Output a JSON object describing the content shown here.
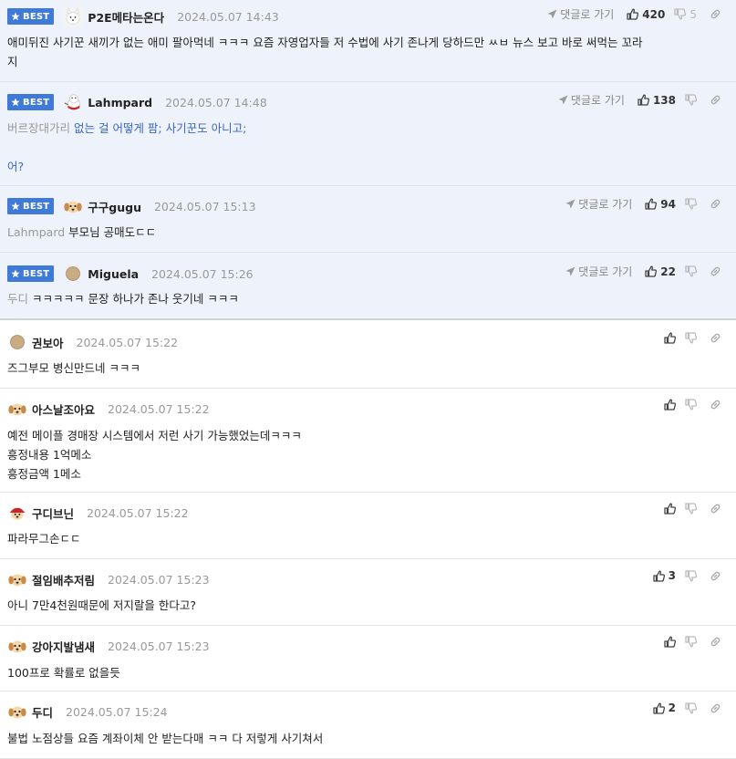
{
  "labels": {
    "best": "BEST",
    "reply": "댓글로 가기"
  },
  "colors": {
    "best_bg": "#eef2fb",
    "badge": "#3f7ad8",
    "mention_gray": "#999999",
    "link_blue": "#3a66c4"
  },
  "comments": [
    {
      "best": true,
      "avatar": "white-dog-icon",
      "nick": "P2E메타는온다",
      "date": "2024.05.07 14:43",
      "likes": "420",
      "dislikes": "5",
      "mention": "",
      "lines": [
        "애미뒤진 사기꾼 새끼가 없는 애미 팔아먹네 ㅋㅋㅋ 요즘 자영업자들 저 수법에 사기 존나게 당하드만 ㅆㅂ 뉴스 보고 바로 써먹는 꼬라",
        "지"
      ]
    },
    {
      "best": true,
      "avatar": "snowman-icon",
      "nick": "Lahmpard",
      "date": "2024.05.07 14:48",
      "likes": "138",
      "dislikes": "",
      "mention": "버르장대가리",
      "lines": [
        "없는 걸 어떻게 팜; 사기꾼도 아니고;",
        "",
        "어?"
      ]
    },
    {
      "best": true,
      "avatar": "puppy-icon",
      "nick": "구구gugu",
      "date": "2024.05.07 15:13",
      "likes": "94",
      "dislikes": "",
      "mention": "Lahmpard",
      "lines": [
        "부모님 공매도ㄷㄷ"
      ]
    },
    {
      "best": true,
      "avatar": "circle-icon",
      "nick": "Miguela",
      "date": "2024.05.07 15:26",
      "likes": "22",
      "dislikes": "",
      "mention": "두디",
      "lines": [
        "ㅋㅋㅋㅋㅋ 문장 하나가 존나 웃기네 ㅋㅋㅋ"
      ]
    },
    {
      "best": false,
      "avatar": "circle-icon",
      "nick": "권보아",
      "date": "2024.05.07 15:22",
      "likes": "",
      "dislikes": "",
      "mention": "",
      "lines": [
        "즈그부모 병신만드네 ㅋㅋㅋ"
      ]
    },
    {
      "best": false,
      "avatar": "puppy-icon",
      "nick": "아스날조아요",
      "date": "2024.05.07 15:22",
      "likes": "",
      "dislikes": "",
      "mention": "",
      "lines": [
        "예전 메이플 경매장 시스템에서 저런 사기 가능했었는데ㅋㅋㅋ",
        "흥정내용 1억메소",
        "흥정금액 1메소"
      ]
    },
    {
      "best": false,
      "avatar": "puppy-hat-icon",
      "nick": "구디브닌",
      "date": "2024.05.07 15:22",
      "likes": "",
      "dislikes": "",
      "mention": "",
      "lines": [
        "파라무그손ㄷㄷ"
      ]
    },
    {
      "best": false,
      "avatar": "puppy-icon",
      "nick": "절임배추저림",
      "date": "2024.05.07 15:23",
      "likes": "3",
      "dislikes": "",
      "mention": "",
      "lines": [
        "아니 7만4천원때문에 저지랄을 한다고?"
      ]
    },
    {
      "best": false,
      "avatar": "puppy-icon",
      "nick": "강아지발냄새",
      "date": "2024.05.07 15:23",
      "likes": "",
      "dislikes": "",
      "mention": "",
      "lines": [
        "100프로 확률로 없을듯"
      ]
    },
    {
      "best": false,
      "avatar": "puppy-icon",
      "nick": "두디",
      "date": "2024.05.07 15:24",
      "likes": "2",
      "dislikes": "",
      "mention": "",
      "lines": [
        "불법 노점상들 요즘 계좌이체 안 받는다매 ㅋㅋ 다 저렇게 사기쳐서"
      ]
    }
  ]
}
